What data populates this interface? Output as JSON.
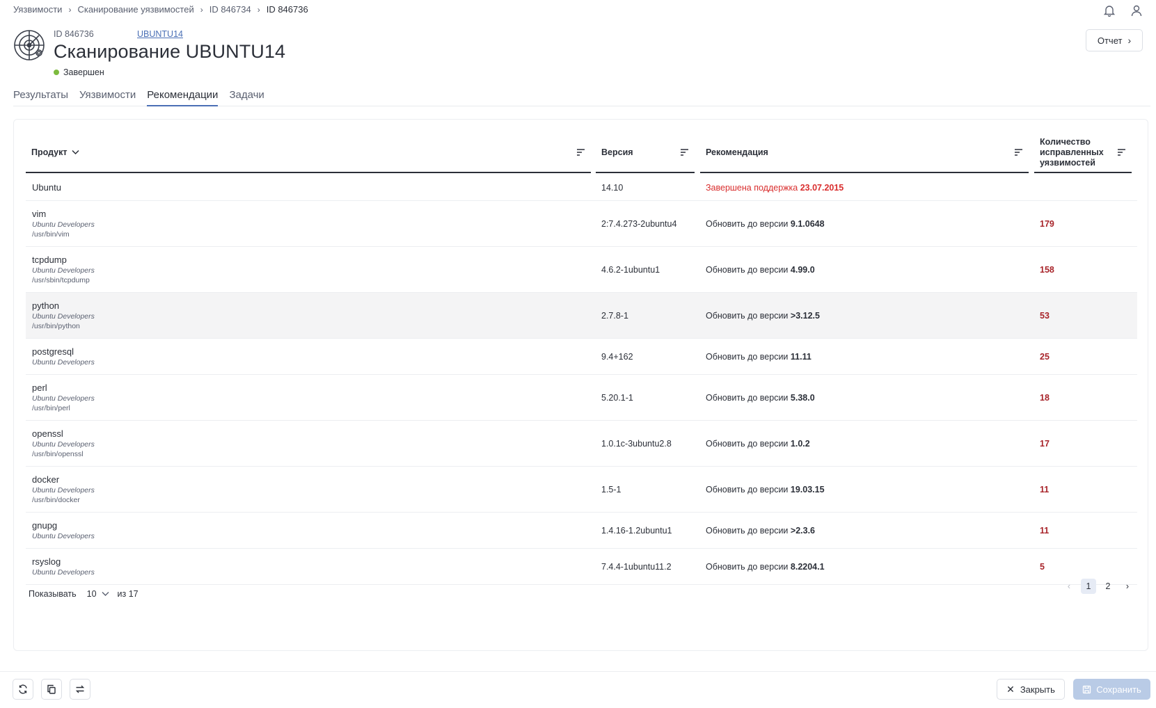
{
  "breadcrumb": {
    "items": [
      "Уязвимости",
      "Сканирование уязвимостей",
      "ID 846734"
    ],
    "current": "ID 846736"
  },
  "header": {
    "id_label": "ID 846736",
    "host_link": "UBUNTU14",
    "title": "Сканирование UBUNTU14",
    "status": "Завершен",
    "status_color": "#7dbb3e",
    "report_button": "Отчет"
  },
  "tabs": [
    {
      "label": "Результаты",
      "active": false
    },
    {
      "label": "Уязвимости",
      "active": false
    },
    {
      "label": "Рекомендации",
      "active": true
    },
    {
      "label": "Задачи",
      "active": false
    }
  ],
  "table": {
    "columns": {
      "product": "Продукт",
      "version": "Версия",
      "recommendation": "Рекомендация",
      "count": "Количество исправленных уязвимостей"
    },
    "rows": [
      {
        "name": "Ubuntu",
        "vendor": "",
        "path": "",
        "version": "14.10",
        "rec_prefix": "Завершена поддержка",
        "rec_value": "23.07.2015",
        "eol": true,
        "count": ""
      },
      {
        "name": "vim",
        "vendor": "Ubuntu Developers",
        "path": "/usr/bin/vim",
        "version": "2:7.4.273-2ubuntu4",
        "rec_prefix": "Обновить до версии",
        "rec_value": "9.1.0648",
        "eol": false,
        "count": "179"
      },
      {
        "name": "tcpdump",
        "vendor": "Ubuntu Developers",
        "path": "/usr/sbin/tcpdump",
        "version": "4.6.2-1ubuntu1",
        "rec_prefix": "Обновить до версии",
        "rec_value": "4.99.0",
        "eol": false,
        "count": "158"
      },
      {
        "name": "python",
        "vendor": "Ubuntu Developers",
        "path": "/usr/bin/python",
        "version": "2.7.8-1",
        "rec_prefix": "Обновить до версии",
        "rec_value": ">3.12.5",
        "eol": false,
        "count": "53"
      },
      {
        "name": "postgresql",
        "vendor": "Ubuntu Developers",
        "path": "",
        "version": "9.4+162",
        "rec_prefix": "Обновить до версии",
        "rec_value": "11.11",
        "eol": false,
        "count": "25"
      },
      {
        "name": "perl",
        "vendor": "Ubuntu Developers",
        "path": "/usr/bin/perl",
        "version": "5.20.1-1",
        "rec_prefix": "Обновить до версии",
        "rec_value": "5.38.0",
        "eol": false,
        "count": "18"
      },
      {
        "name": "openssl",
        "vendor": "Ubuntu Developers",
        "path": "/usr/bin/openssl",
        "version": "1.0.1c-3ubuntu2.8",
        "rec_prefix": "Обновить до версии",
        "rec_value": "1.0.2",
        "eol": false,
        "count": "17"
      },
      {
        "name": "docker",
        "vendor": "Ubuntu Developers",
        "path": "/usr/bin/docker",
        "version": "1.5-1",
        "rec_prefix": "Обновить до версии",
        "rec_value": "19.03.15",
        "eol": false,
        "count": "11"
      },
      {
        "name": "gnupg",
        "vendor": "Ubuntu Developers",
        "path": "",
        "version": "1.4.16-1.2ubuntu1",
        "rec_prefix": "Обновить до версии",
        "rec_value": ">2.3.6",
        "eol": false,
        "count": "11"
      },
      {
        "name": "rsyslog",
        "vendor": "Ubuntu Developers",
        "path": "",
        "version": "7.4.4-1ubuntu11.2",
        "rec_prefix": "Обновить до версии",
        "rec_value": "8.2204.1",
        "eol": false,
        "count": "5"
      }
    ]
  },
  "pagination": {
    "show_label": "Показывать",
    "page_size": "10",
    "total_label": "из 17",
    "pages": [
      "1",
      "2"
    ],
    "current_page": "1"
  },
  "footer": {
    "close_button": "Закрыть",
    "save_button": "Сохранить"
  },
  "colors": {
    "accent": "#4a6fb5",
    "count_red": "#a8242a",
    "eol_red": "#d92e2e",
    "save_disabled": "#b9cbe6"
  }
}
